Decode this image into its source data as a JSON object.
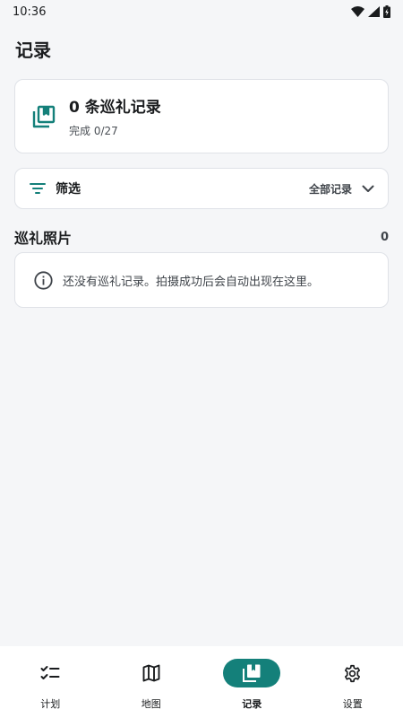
{
  "status_bar": {
    "time": "10:36",
    "icons": [
      "wifi-icon",
      "signal-icon",
      "battery-icon"
    ]
  },
  "page": {
    "title": "记录"
  },
  "summary": {
    "icon": "photo-library-icon",
    "title": "0 条巡礼记录",
    "subtitle": "完成 0/27"
  },
  "filter": {
    "icon": "filter-icon",
    "label": "筛选",
    "value": "全部记录"
  },
  "photos_section": {
    "title": "巡礼照片",
    "count": "0"
  },
  "empty_state": {
    "icon": "info-icon",
    "message": "还没有巡礼记录。拍摄成功后会自动出现在这里。"
  },
  "bottom_nav": {
    "items": [
      {
        "label": "计划",
        "icon": "checklist-icon",
        "active": false
      },
      {
        "label": "地图",
        "icon": "map-icon",
        "active": false
      },
      {
        "label": "记录",
        "icon": "photo-library-icon",
        "active": true
      },
      {
        "label": "设置",
        "icon": "gear-icon",
        "active": false
      }
    ]
  },
  "colors": {
    "accent": "#14807a",
    "background": "#f5f6f8",
    "card": "#ffffff",
    "border": "#dfe2e7"
  }
}
